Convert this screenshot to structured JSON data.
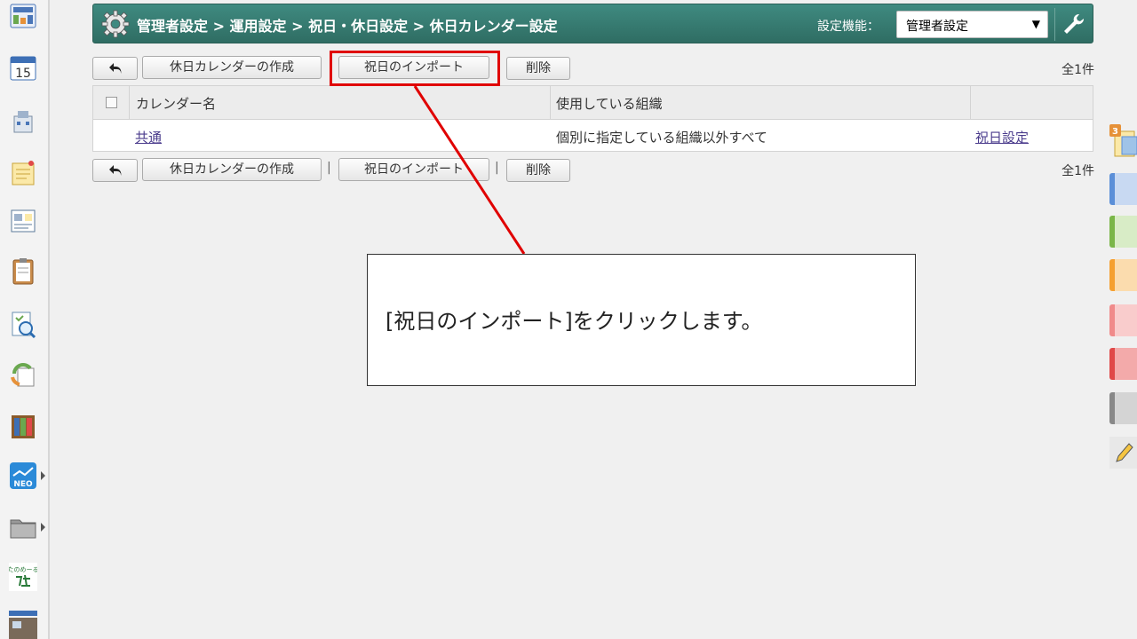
{
  "header": {
    "breadcrumb": "管理者設定 > 運用設定 > 祝日・休日設定 > 休日カレンダー設定",
    "settings_label": "設定機能：",
    "settings_value": "管理者設定",
    "settings_caret": "▼"
  },
  "toolbar_top": {
    "back_icon": "back-arrow-icon",
    "create_label": "休日カレンダーの作成",
    "import_label": "祝日のインポート",
    "delete_label": "削除",
    "count": "全1件"
  },
  "toolbar_bottom": {
    "create_label": "休日カレンダーの作成",
    "separator": "|",
    "import_label": "祝日のインポート",
    "delete_label": "削除",
    "count": "全1件"
  },
  "table": {
    "headers": [
      "カレンダー名",
      "使用している組織"
    ],
    "rows": [
      {
        "name": "共通",
        "org": "個別に指定している組織以外すべて",
        "action": "祝日設定"
      }
    ]
  },
  "left_sidebar": {
    "calendar_day": "15",
    "icons": [
      "portal-icon",
      "calendar-icon",
      "facility-icon",
      "memo-icon",
      "bulletin-icon",
      "clipboard-icon",
      "workflow-search-icon",
      "sync-icon",
      "cabinet-icon",
      "neo-icon",
      "folder-icon",
      "tanomail-icon",
      "app-thumbnail-icon"
    ],
    "neo_label": "NEO",
    "tanomail_label": "たのめーる"
  },
  "right_sidebar": {
    "badge": "3",
    "tab_colors": [
      "#5b8fd8",
      "#7ab648",
      "#f5a030",
      "#f08a8a",
      "#e04848",
      "#888888"
    ]
  },
  "annotation": {
    "callout_text": "[祝日のインポート]をクリックします。"
  }
}
